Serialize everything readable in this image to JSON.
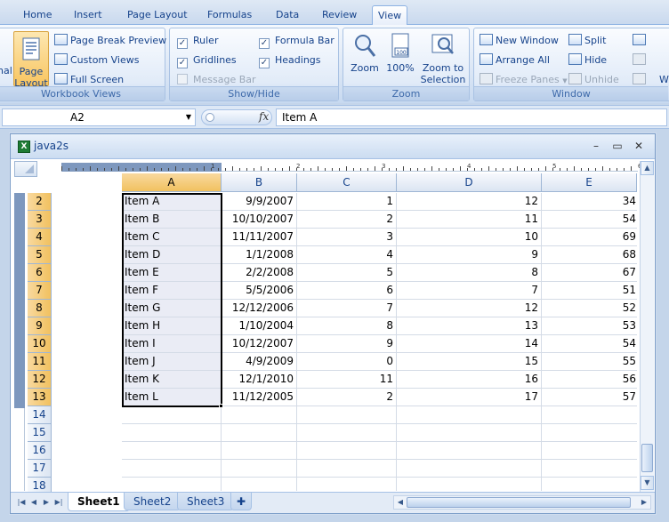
{
  "tabs": [
    "Home",
    "Insert",
    "Page Layout",
    "Formulas",
    "Data",
    "Review",
    "View"
  ],
  "active_tab": "View",
  "ribbon": {
    "workbook_views": {
      "label": "Workbook Views",
      "normal": "nal",
      "page_layout_line1": "Page",
      "page_layout_line2": "Layout",
      "page_break_preview": "Page Break Preview",
      "custom_views": "Custom Views",
      "full_screen": "Full Screen"
    },
    "show_hide": {
      "label": "Show/Hide",
      "ruler": "Ruler",
      "gridlines": "Gridlines",
      "message_bar": "Message Bar",
      "formula_bar": "Formula Bar",
      "headings": "Headings",
      "check": "✓"
    },
    "zoom": {
      "label": "Zoom",
      "zoom": "Zoom",
      "zoom_100": "100%",
      "zoom_sel_line1": "Zoom to",
      "zoom_sel_line2": "Selection",
      "icon_text": "100"
    },
    "window": {
      "label": "Window",
      "new_window": "New Window",
      "arrange_all": "Arrange All",
      "freeze_panes": "Freeze Panes",
      "split": "Split",
      "hide": "Hide",
      "unhide": "Unhide",
      "overflow": "W"
    }
  },
  "formula_bar": {
    "name_box": "A2",
    "fx": "fx",
    "content": "Item A"
  },
  "workbook": {
    "title": "java2s",
    "controls": {
      "minimize": "–",
      "restore": "▭",
      "close": "✕"
    },
    "ruler_numbers": [
      "1",
      "2",
      "3",
      "4",
      "5",
      "6"
    ],
    "columns": [
      "A",
      "B",
      "C",
      "D",
      "E"
    ],
    "selected_column": "A",
    "rows": [
      {
        "n": "2",
        "a": "Item A",
        "b": "9/9/2007",
        "c": "1",
        "d": "12",
        "e": "34"
      },
      {
        "n": "3",
        "a": "Item B",
        "b": "10/10/2007",
        "c": "2",
        "d": "11",
        "e": "54"
      },
      {
        "n": "4",
        "a": "Item C",
        "b": "11/11/2007",
        "c": "3",
        "d": "10",
        "e": "69"
      },
      {
        "n": "5",
        "a": "Item D",
        "b": "1/1/2008",
        "c": "4",
        "d": "9",
        "e": "68"
      },
      {
        "n": "6",
        "a": "Item E",
        "b": "2/2/2008",
        "c": "5",
        "d": "8",
        "e": "67"
      },
      {
        "n": "7",
        "a": "Item F",
        "b": "5/5/2006",
        "c": "6",
        "d": "7",
        "e": "51"
      },
      {
        "n": "8",
        "a": "Item G",
        "b": "12/12/2006",
        "c": "7",
        "d": "12",
        "e": "52"
      },
      {
        "n": "9",
        "a": "Item H",
        "b": "1/10/2004",
        "c": "8",
        "d": "13",
        "e": "53"
      },
      {
        "n": "10",
        "a": "Item I",
        "b": "10/12/2007",
        "c": "9",
        "d": "14",
        "e": "54"
      },
      {
        "n": "11",
        "a": "Item J",
        "b": "4/9/2009",
        "c": "0",
        "d": "15",
        "e": "55"
      },
      {
        "n": "12",
        "a": "Item K",
        "b": "12/1/2010",
        "c": "11",
        "d": "16",
        "e": "56"
      },
      {
        "n": "13",
        "a": "Item L",
        "b": "11/12/2005",
        "c": "2",
        "d": "17",
        "e": "57"
      },
      {
        "n": "14",
        "a": "",
        "b": "",
        "c": "",
        "d": "",
        "e": ""
      },
      {
        "n": "15",
        "a": "",
        "b": "",
        "c": "",
        "d": "",
        "e": ""
      },
      {
        "n": "16",
        "a": "",
        "b": "",
        "c": "",
        "d": "",
        "e": ""
      },
      {
        "n": "17",
        "a": "",
        "b": "",
        "c": "",
        "d": "",
        "e": ""
      },
      {
        "n": "18",
        "a": "",
        "b": "",
        "c": "",
        "d": "",
        "e": ""
      }
    ],
    "selected_rows": [
      "2",
      "3",
      "4",
      "5",
      "6",
      "7",
      "8",
      "9",
      "10",
      "11",
      "12",
      "13"
    ],
    "sheets": [
      "Sheet1",
      "Sheet2",
      "Sheet3"
    ],
    "active_sheet": "Sheet1"
  },
  "colors": {
    "ribbon_text": "#15428b",
    "selected_header": "#f1c15f",
    "selected_fill": "#eaecf5"
  }
}
